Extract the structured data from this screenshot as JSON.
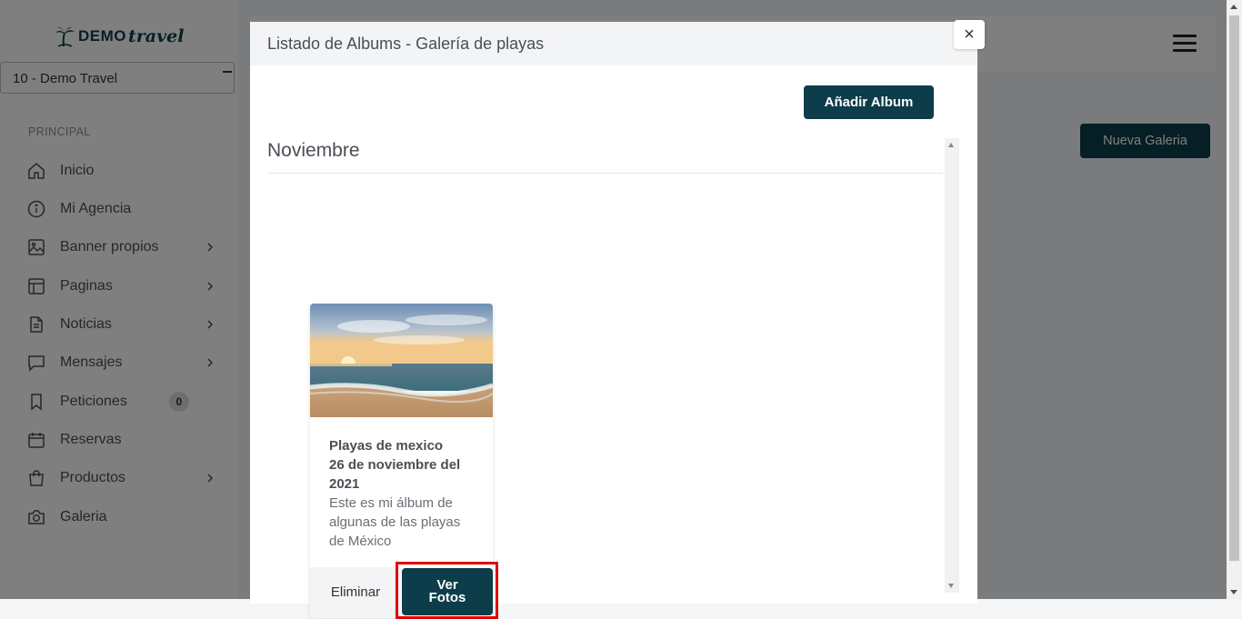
{
  "brand": {
    "logo_demo": "DEMO",
    "logo_travel": "travel"
  },
  "sidebar": {
    "agency_select": "10 - Demo Travel",
    "section_label": "PRINCIPAL",
    "items": [
      {
        "label": "Inicio",
        "icon": "home-icon"
      },
      {
        "label": "Mi Agencia",
        "icon": "info-icon"
      },
      {
        "label": "Banner propios",
        "icon": "image-icon"
      },
      {
        "label": "Paginas",
        "icon": "layout-icon"
      },
      {
        "label": "Noticias",
        "icon": "document-icon"
      },
      {
        "label": "Mensajes",
        "icon": "message-icon"
      },
      {
        "label": "Peticiones",
        "icon": "bookmark-icon",
        "badge": "0"
      },
      {
        "label": "Reservas",
        "icon": "calendar-icon"
      },
      {
        "label": "Productos",
        "icon": "shopping-bag-icon"
      },
      {
        "label": "Galeria",
        "icon": "camera-icon"
      }
    ]
  },
  "main": {
    "new_gallery_button": "Nueva Galeria"
  },
  "modal": {
    "title": "Listado de Albums - Galería de playas",
    "close_label": "×",
    "add_album_button": "Añadir Album",
    "month": "Noviembre",
    "albums": [
      {
        "title": "Playas de mexico",
        "date": "26 de noviembre del 2021",
        "description": "Este es mi álbum de algunas de las playas de México",
        "delete_button": "Eliminar",
        "view_button": "Ver Fotos"
      }
    ]
  },
  "colors": {
    "primary": "#0d3d4a",
    "highlight": "#e00000"
  }
}
